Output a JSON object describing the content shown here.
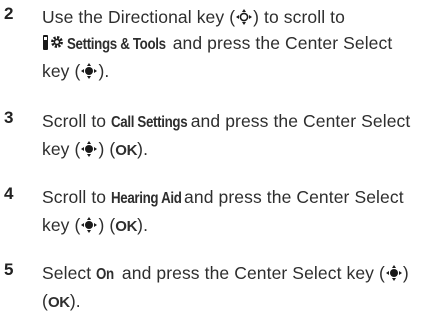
{
  "steps": [
    {
      "number": "2",
      "text_a": "Use the Directional key (",
      "text_b": ") to scroll to",
      "menu_label": "Settings & Tools",
      "text_c": " and press the Center Select",
      "text_d": "key (",
      "text_e": ")."
    },
    {
      "number": "3",
      "text_a": "Scroll to ",
      "menu_label": "Call Settings",
      "text_b": " and press the Center Select",
      "text_c": "key (",
      "text_d": ") (",
      "ok": "OK",
      "text_e": ")."
    },
    {
      "number": "4",
      "text_a": "Scroll to ",
      "menu_label": "Hearing Aid",
      "text_b": " and press the Center Select",
      "text_c": "key (",
      "text_d": ") (",
      "ok": "OK",
      "text_e": ")."
    },
    {
      "number": "5",
      "text_a": "Select ",
      "menu_label": "On",
      "text_b": " and press the Center Select key (",
      "text_c": ")",
      "text_d": "(",
      "ok": "OK",
      "text_e": ")."
    }
  ],
  "icons": {
    "directional_key": "directional-key-icon",
    "center_select_key": "center-select-key-icon",
    "settings_tools": "settings-tools-icon"
  },
  "colors": {
    "text": "#2e2e2e",
    "icon": "#1a1a1a"
  }
}
